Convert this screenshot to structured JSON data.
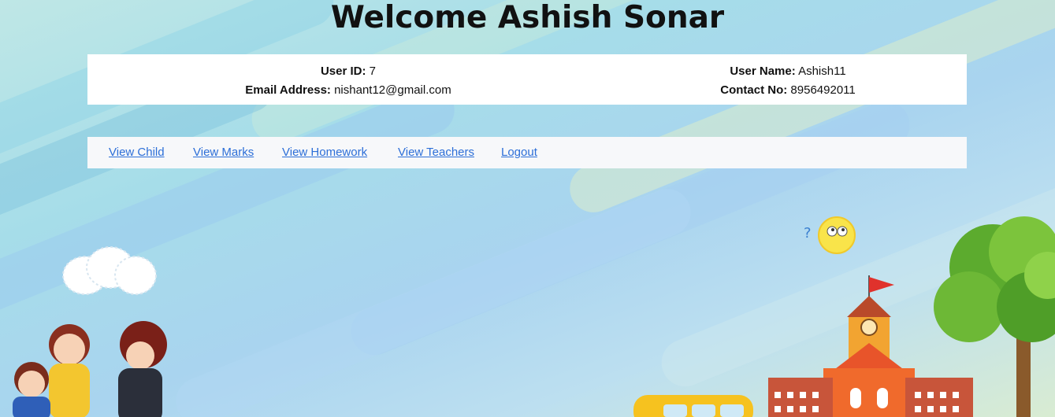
{
  "page": {
    "title": "Welcome Ashish Sonar"
  },
  "user_info": {
    "user_id_label": "User ID:",
    "user_id_value": "7",
    "email_label": "Email Address:",
    "email_value": "nishant12@gmail.com",
    "user_name_label": "User Name:",
    "user_name_value": "Ashish11",
    "contact_label": "Contact No:",
    "contact_value": "8956492011"
  },
  "nav": {
    "items": [
      {
        "label": "View Child"
      },
      {
        "label": "View Marks"
      },
      {
        "label": "View Homework"
      },
      {
        "label": "View Teachers"
      },
      {
        "label": "Logout"
      }
    ]
  },
  "colors": {
    "link": "#2d6fd8",
    "card_bg": "#ffffff",
    "nav_bg": "#f7f8fa"
  }
}
